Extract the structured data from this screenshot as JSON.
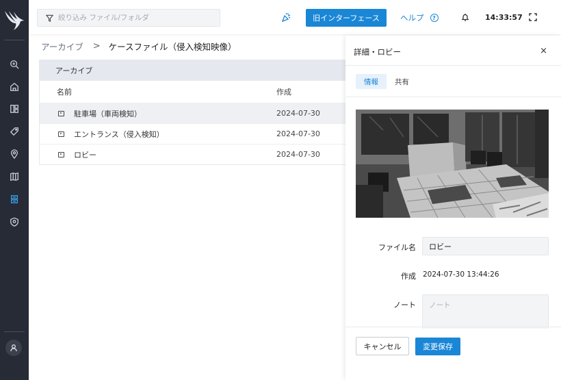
{
  "search": {
    "placeholder": "絞り込み ファイル/フォルダ"
  },
  "topbar": {
    "old_ui_label": "旧インターフェース",
    "help_label": "ヘルプ",
    "help_glyph": "?",
    "clock": "14:33:57"
  },
  "breadcrumb": {
    "root": "アーカイブ",
    "separator": ">",
    "current": "ケースファイル（侵入検知映像）"
  },
  "table": {
    "group_header": "アーカイブ",
    "columns": [
      "名前",
      "作成"
    ],
    "rows": [
      {
        "name": "駐車場（車両検知）",
        "created": "2024-07-30",
        "selected": true
      },
      {
        "name": "エントランス（侵入検知）",
        "created": "2024-07-30",
        "selected": false
      },
      {
        "name": "ロビー",
        "created": "2024-07-30",
        "selected": false
      }
    ]
  },
  "panel": {
    "title": "詳細・ロビー",
    "close_glyph": "×",
    "tabs": [
      {
        "label": "情報",
        "active": true
      },
      {
        "label": "共有",
        "active": false
      }
    ],
    "fields": {
      "filename_label": "ファイル名",
      "filename_value": "ロビー",
      "created_label": "作成",
      "created_value": "2024-07-30 13:44:26",
      "note_label": "ノート",
      "note_placeholder": "ノート"
    },
    "cancel_label": "キャンセル",
    "save_label": "変更保存"
  },
  "colors": {
    "accent": "#1a86d6",
    "rail": "#262b36",
    "rail_active": "#3aa0e8"
  },
  "icons": {
    "rail": [
      "search-zoom-icon",
      "home-icon",
      "dashboard-icon",
      "tag-icon",
      "location-pin-icon",
      "map-icon",
      "archive-icon",
      "shield-icon"
    ],
    "topbar": [
      "filter-icon",
      "party-popper-icon",
      "help-circle-icon",
      "bell-icon",
      "fullscreen-icon"
    ]
  }
}
